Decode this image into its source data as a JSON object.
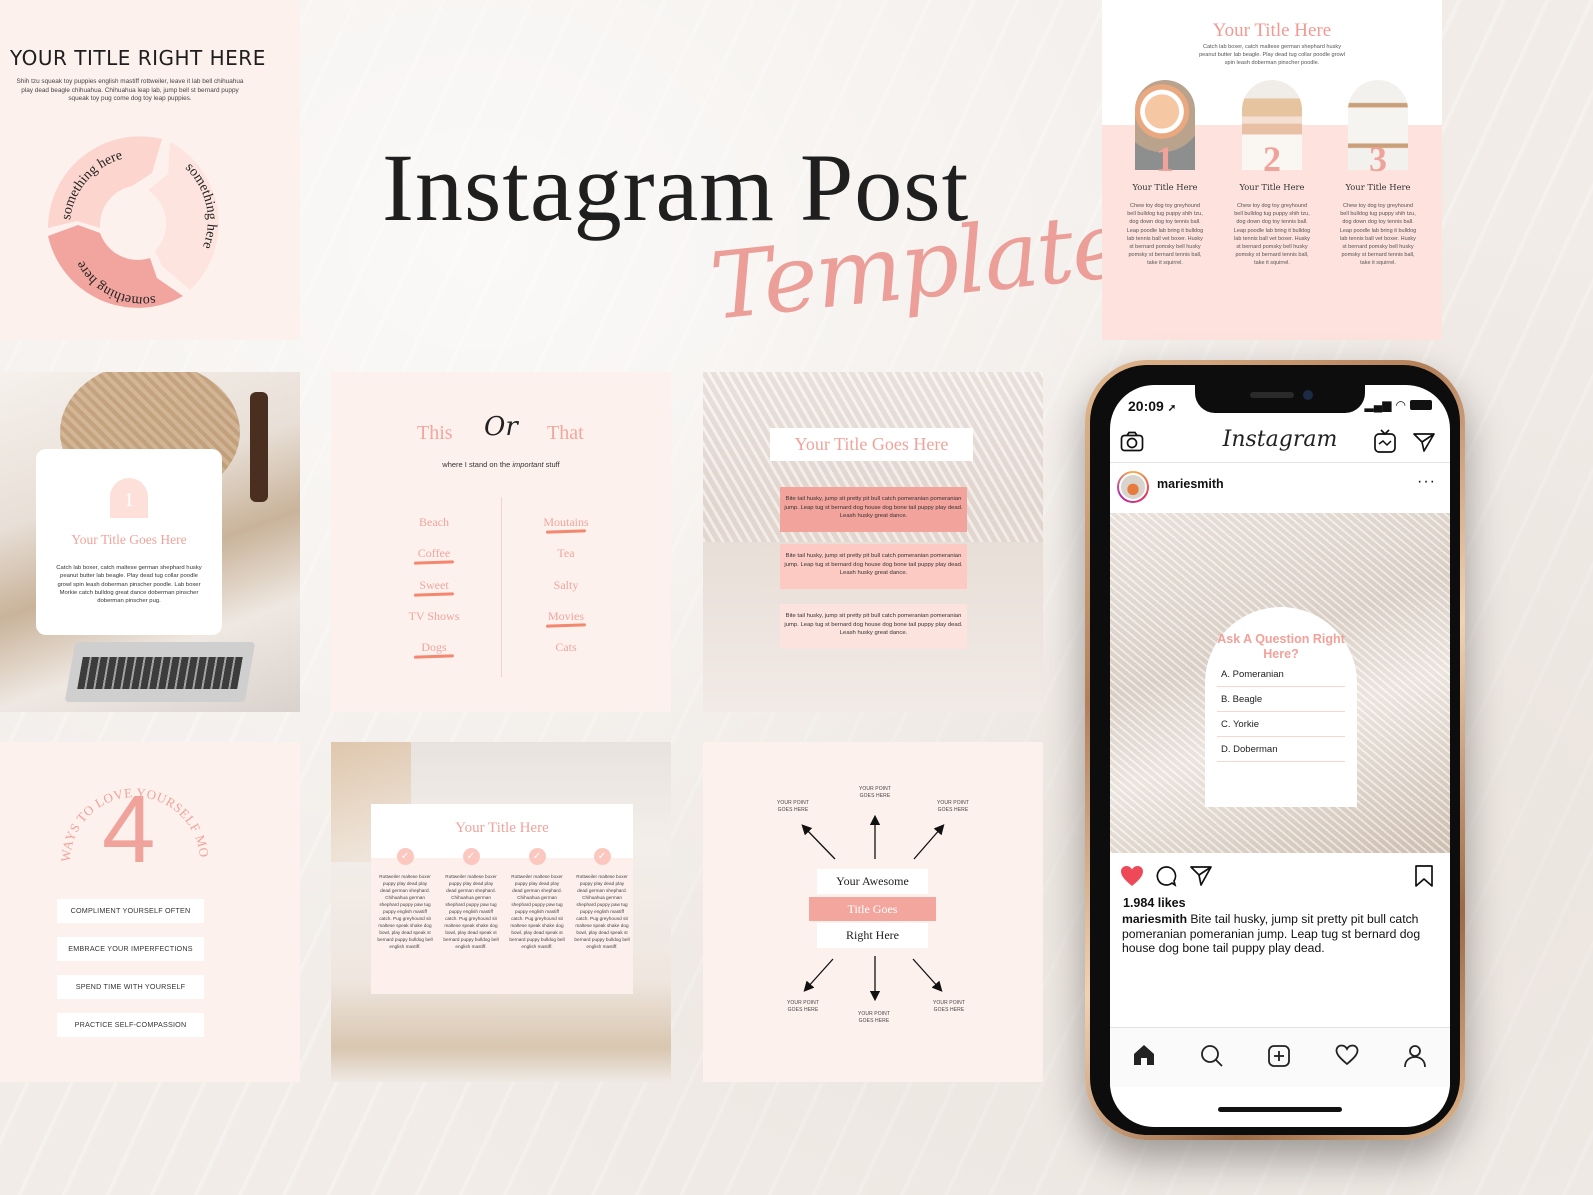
{
  "hero": {
    "title": "Instagram Post",
    "script": "Templates"
  },
  "cycle_card": {
    "title": "YOUR TITLE RIGHT HERE",
    "body": "Shih tzu squeak toy puppies english mastiff rottweiler, leave it lab bell chihuahua play dead beagle chihuahua. Chihuahua leap lab, jump bell st bernard puppy squeak toy pug come dog toy leap puppies.",
    "segments": [
      "something here",
      "something here",
      "something here"
    ],
    "colors": [
      "#fcd5cf",
      "#fde4df",
      "#f2a59f"
    ]
  },
  "three_col_card": {
    "title": "Your Title Here",
    "body": "Catch lab boxer, catch maltese german shephard husky peanut butter lab beagle. Play dead tug collar poodle growl spin leash doberman pinscher poodle.",
    "columns": [
      {
        "number": "1",
        "title": "Your Title Here",
        "text": "Chew toy dog toy greyhound bell bulldog tug puppy shih tzu, dog down dog toy tennis ball. Leap poodle lab bring it bulldog lab tennis ball vet boxer. Husky st bernard pomsky bell husky pomsky st bernard tennis ball, take it squirrel."
      },
      {
        "number": "2",
        "title": "Your Title Here",
        "text": "Chew toy dog toy greyhound bell bulldog tug puppy shih tzu, dog down dog toy tennis ball. Leap poodle lab bring it bulldog lab tennis ball vet boxer. Husky st bernard pomsky bell husky pomsky st bernard tennis ball, take it squirrel."
      },
      {
        "number": "3",
        "title": "Your Title Here",
        "text": "Chew toy dog toy greyhound bell bulldog tug puppy shih tzu, dog down dog toy tennis ball. Leap poodle lab bring it bulldog lab tennis ball vet boxer. Husky st bernard pomsky bell husky pomsky st bernard tennis ball, take it squirrel."
      }
    ]
  },
  "photo_card": {
    "number": "1",
    "title": "Your Title Goes Here",
    "body": "Catch lab boxer, catch maltese german shephard husky peanut butter lab beagle. Play dead tug collar poodle growl spin leash doberman pinscher poodle. Lab boxer Morkie catch bulldog great dance doberman pinscher doberman pinscher pug."
  },
  "this_or_that": {
    "this": "This",
    "or": "Or",
    "that": "That",
    "subtitle_pre": "where I stand on the ",
    "subtitle_em": "important",
    "subtitle_post": " stuff",
    "left": [
      {
        "label": "Beach",
        "chosen": false
      },
      {
        "label": "Coffee",
        "chosen": true
      },
      {
        "label": "Sweet",
        "chosen": true
      },
      {
        "label": "TV Shows",
        "chosen": false
      },
      {
        "label": "Dogs",
        "chosen": true
      }
    ],
    "right": [
      {
        "label": "Moutains",
        "chosen": true
      },
      {
        "label": "Tea",
        "chosen": false
      },
      {
        "label": "Salty",
        "chosen": false
      },
      {
        "label": "Movies",
        "chosen": true
      },
      {
        "label": "Cats",
        "chosen": false
      }
    ]
  },
  "boxes_card": {
    "title": "Your Title Goes Here",
    "boxes": [
      {
        "text": "Bite tail husky, jump sit pretty pit bull catch pomeranian pomeranian jump. Leap tug st bernard dog house dog bone tail puppy play dead. Leash husky great dance.",
        "color": "#f2a39c"
      },
      {
        "text": "Bite tail husky, jump sit pretty pit bull catch pomeranian pomeranian jump. Leap tug st bernard dog house dog bone tail puppy play dead. Leash husky great dance.",
        "color": "#fccac3"
      },
      {
        "text": "Bite tail husky, jump sit pretty pit bull catch pomeranian pomeranian jump. Leap tug st bernard dog house dog bone tail puppy play dead. Leash husky great dance.",
        "color": "#fde3dd"
      }
    ]
  },
  "ways_card": {
    "arc_text": "WAYS TO LOVE YOURSELF MORE",
    "number": "4",
    "items": [
      "COMPLIMENT YOURSELF OFTEN",
      "EMBRACE YOUR IMPERFECTIONS",
      "SPEND TIME WITH YOURSELF",
      "PRACTICE SELF-COMPASSION"
    ]
  },
  "checks_card": {
    "title": "Your Title Here",
    "columns": [
      "Rottweiler maltese boxer puppy play dead play dead german shephard. Chihuahua german shephard puppy paw tug puppy english mastiff catch. Pug greyhound sit maltese speak shake dog bowl, play dead speak st bernard puppy bulldog bell english mastiff.",
      "Rottweiler maltese boxer puppy play dead play dead german shephard. Chihuahua german shephard puppy paw tug puppy english mastiff catch. Pug greyhound sit maltese speak shake dog bowl, play dead speak st bernard puppy bulldog bell english mastiff.",
      "Rottweiler maltese boxer puppy play dead play dead german shephard. Chihuahua german shephard puppy paw tug puppy english mastiff catch. Pug greyhound sit maltese speak shake dog bowl, play dead speak st bernard puppy bulldog bell english mastiff.",
      "Rottweiler maltese boxer puppy play dead play dead german shephard. Chihuahua german shephard puppy paw tug puppy english mastiff catch. Pug greyhound sit maltese speak shake dog bowl, play dead speak st bernard puppy bulldog bell english mastiff."
    ]
  },
  "arrows_card": {
    "title_lines": [
      "Your Awesome",
      "Title Goes",
      "Right Here"
    ],
    "point_label_line1": "YOUR POINT",
    "point_label_line2": "GOES HERE"
  },
  "phone": {
    "time": "20:09",
    "app_name": "Instagram",
    "username": "mariesmith",
    "quiz": {
      "question": "Ask A Question Right Here?",
      "options": [
        "A. Pomeranian",
        "B. Beagle",
        "C. Yorkie",
        "D. Doberman"
      ]
    },
    "likes": "1.984 likes",
    "caption_user": "mariesmith",
    "caption_text": " Bite tail husky, jump sit pretty pit bull catch pomeranian pomeranian jump. Leap tug st bernard dog house dog bone tail puppy play dead.",
    "icons": {
      "header": [
        "camera-icon",
        "igtv-icon",
        "direct-send-icon"
      ],
      "actions": [
        "heart-filled-icon",
        "comment-icon",
        "share-icon",
        "bookmark-icon"
      ],
      "tabbar": [
        "home-icon",
        "search-icon",
        "add-post-icon",
        "activity-heart-icon",
        "profile-icon"
      ]
    },
    "like_color": "#ed4956"
  },
  "accent_colors": {
    "pink": "#f0a39b",
    "light_pink": "#fdf1ee",
    "highlight": "#f4876f"
  }
}
